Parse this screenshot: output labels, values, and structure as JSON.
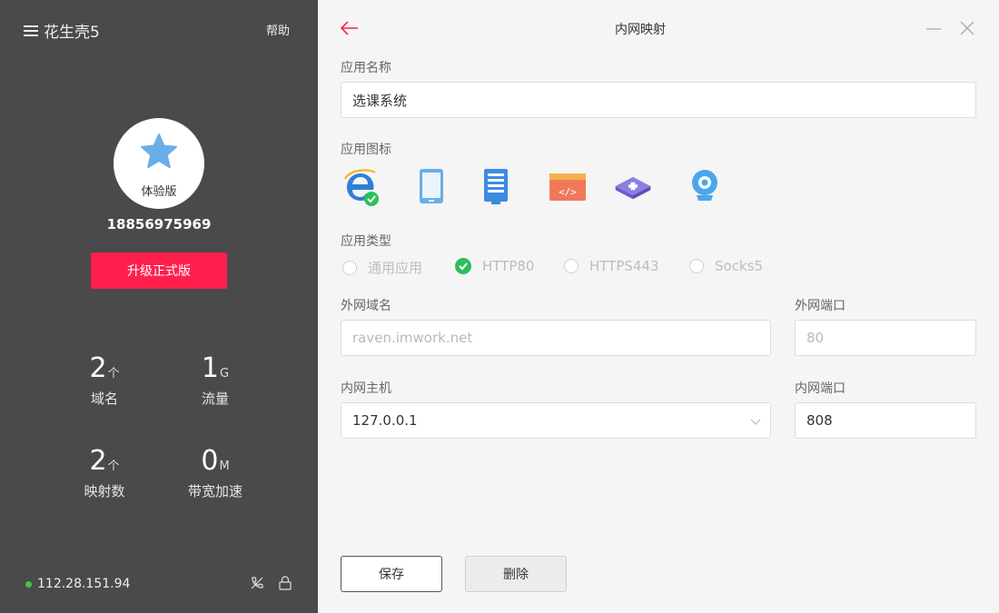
{
  "sidebar": {
    "app_title": "花生壳5",
    "help": "帮助",
    "edition": "体验版",
    "phone": "18856975969",
    "upgrade": "升级正式版",
    "stats": [
      {
        "value": "2",
        "unit": "个",
        "label": "域名"
      },
      {
        "value": "1",
        "unit": "G",
        "label": "流量"
      },
      {
        "value": "2",
        "unit": "个",
        "label": "映射数"
      },
      {
        "value": "0",
        "unit": "M",
        "label": "带宽加速"
      }
    ],
    "ip": "112.28.151.94",
    "status_color": "#3ec84a"
  },
  "main": {
    "title": "内网映射",
    "app_name_label": "应用名称",
    "app_name_value": "选课系统",
    "app_icon_label": "应用图标",
    "icons": [
      "ie-browser-icon",
      "tablet-icon",
      "server-icon",
      "code-window-icon",
      "router-icon",
      "webcam-icon"
    ],
    "app_type_label": "应用类型",
    "types": [
      "通用应用",
      "HTTP80",
      "HTTPS443",
      "Socks5"
    ],
    "selected_type": "HTTP80",
    "ext_domain_label": "外网域名",
    "ext_domain_value": "raven.imwork.net",
    "ext_port_label": "外网端口",
    "ext_port_value": "80",
    "int_host_label": "内网主机",
    "int_host_value": "127.0.0.1",
    "int_port_label": "内网端口",
    "int_port_value": "808",
    "save": "保存",
    "delete": "删除"
  },
  "colors": {
    "sidebar_bg": "#4a4a4a",
    "accent": "#ff1f4d",
    "check": "#2bbf5a"
  }
}
